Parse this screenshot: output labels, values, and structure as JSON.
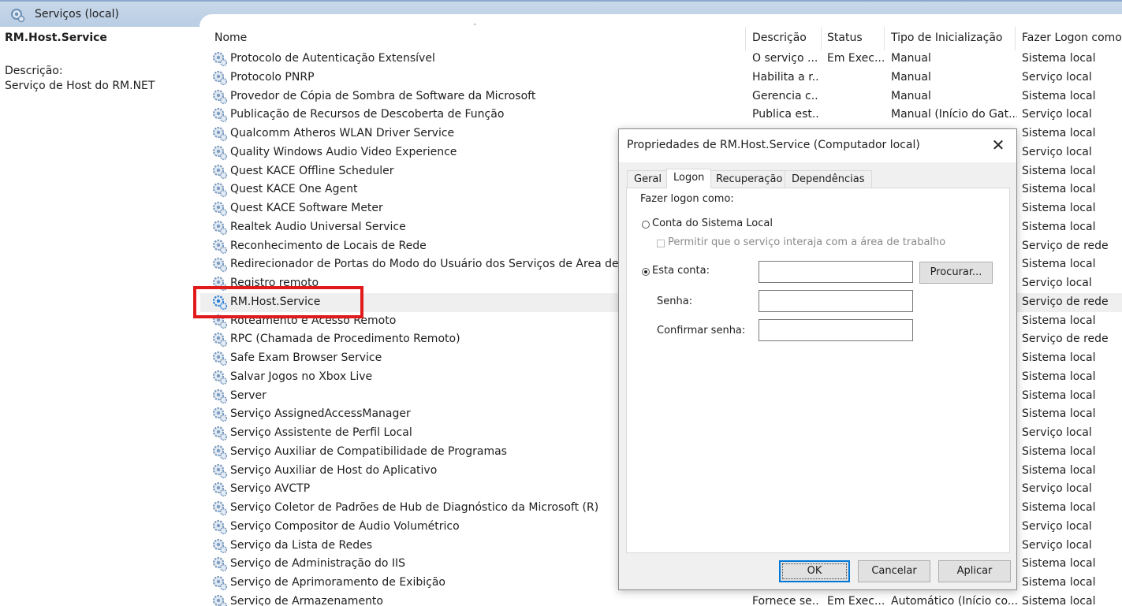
{
  "window": {
    "title": "Serviços (local)"
  },
  "left_pane": {
    "title": "RM.Host.Service",
    "description_label": "Descrição:",
    "description": "Serviço de Host do RM.NET"
  },
  "columns": {
    "name": "Nome",
    "description": "Descrição",
    "status": "Status",
    "startup": "Tipo de Inicialização",
    "logon": "Fazer Logon como"
  },
  "services": [
    {
      "name": "Protocolo de Autenticação Extensível",
      "desc": "O serviço ...",
      "status": "Em Exec...",
      "startup": "Manual",
      "logon": "Sistema local"
    },
    {
      "name": "Protocolo PNRP",
      "desc": "Habilita a r...",
      "status": "",
      "startup": "Manual",
      "logon": "Serviço local"
    },
    {
      "name": "Provedor de Cópia de Sombra de Software da Microsoft",
      "desc": "Gerencia c...",
      "status": "",
      "startup": "Manual",
      "logon": "Sistema local"
    },
    {
      "name": "Publicação de Recursos de Descoberta de Função",
      "desc": "Publica est...",
      "status": "",
      "startup": "Manual (Início do Gat...",
      "logon": "Serviço local"
    },
    {
      "name": "Qualcomm Atheros WLAN Driver Service",
      "desc": "",
      "status": "",
      "startup": "",
      "logon": "Sistema local"
    },
    {
      "name": "Quality Windows Audio Video Experience",
      "desc": "",
      "status": "",
      "startup": "",
      "logon": "Serviço local"
    },
    {
      "name": "Quest KACE Offline Scheduler",
      "desc": "",
      "status": "",
      "startup": "",
      "logon": "Sistema local"
    },
    {
      "name": "Quest KACE One Agent",
      "desc": "",
      "status": "",
      "startup": "",
      "logon": "Sistema local"
    },
    {
      "name": "Quest KACE Software Meter",
      "desc": "",
      "status": "",
      "startup": "",
      "logon": "Sistema local"
    },
    {
      "name": "Realtek Audio Universal Service",
      "desc": "",
      "status": "",
      "startup": "",
      "logon": "Sistema local"
    },
    {
      "name": "Reconhecimento de Locais de Rede",
      "desc": "",
      "status": "",
      "startup": "",
      "logon": "Serviço de rede"
    },
    {
      "name": "Redirecionador de Portas do Modo do Usuário dos Serviços de Área de Trabalho Remota",
      "desc": "",
      "status": "",
      "startup": "",
      "logon": "Sistema local"
    },
    {
      "name": "Registro remoto",
      "desc": "",
      "status": "",
      "startup": "",
      "logon": "Serviço local"
    },
    {
      "name": "RM.Host.Service",
      "desc": "",
      "status": "",
      "startup": "",
      "logon": "Serviço de rede",
      "selected": true
    },
    {
      "name": "Roteamento e Acesso Remoto",
      "desc": "",
      "status": "",
      "startup": "",
      "logon": "Sistema local"
    },
    {
      "name": "RPC (Chamada de Procedimento Remoto)",
      "desc": "",
      "status": "",
      "startup": "",
      "logon": "Serviço de rede"
    },
    {
      "name": "Safe Exam Browser Service",
      "desc": "",
      "status": "",
      "startup": "",
      "logon": "Sistema local"
    },
    {
      "name": "Salvar Jogos no Xbox Live",
      "desc": "",
      "status": "",
      "startup": "",
      "logon": "Sistema local"
    },
    {
      "name": "Server",
      "desc": "",
      "status": "",
      "startup": "",
      "logon": "Sistema local"
    },
    {
      "name": "Serviço AssignedAccessManager",
      "desc": "",
      "status": "",
      "startup": "",
      "logon": "Sistema local"
    },
    {
      "name": "Serviço Assistente de Perfil Local",
      "desc": "",
      "status": "",
      "startup": "",
      "logon": "Serviço local"
    },
    {
      "name": "Serviço Auxiliar de Compatibilidade de Programas",
      "desc": "",
      "status": "",
      "startup": "",
      "logon": "Sistema local"
    },
    {
      "name": "Serviço Auxiliar de Host do Aplicativo",
      "desc": "",
      "status": "",
      "startup": "",
      "logon": "Sistema local"
    },
    {
      "name": "Serviço AVCTP",
      "desc": "",
      "status": "",
      "startup": "",
      "logon": "Serviço local"
    },
    {
      "name": "Serviço Coletor de Padrões de Hub de Diagnóstico da Microsoft (R)",
      "desc": "",
      "status": "",
      "startup": "",
      "logon": "Sistema local"
    },
    {
      "name": "Serviço Compositor de Áudio Volumétrico",
      "desc": "",
      "status": "",
      "startup": "",
      "logon": "Serviço local"
    },
    {
      "name": "Serviço da Lista de Redes",
      "desc": "",
      "status": "",
      "startup": "",
      "logon": "Serviço local"
    },
    {
      "name": "Serviço de Administração do IIS",
      "desc": "",
      "status": "",
      "startup": "",
      "logon": "Sistema local"
    },
    {
      "name": "Serviço de Aprimoramento de Exibição",
      "desc": "",
      "status": "",
      "startup": "",
      "logon": "Sistema local"
    },
    {
      "name": "Serviço de Armazenamento",
      "desc": "Fornece se...",
      "status": "Em Exec...",
      "startup": "Automático (Início co...",
      "logon": "Sistema local"
    }
  ],
  "dialog": {
    "title": "Propriedades de RM.Host.Service (Computador local)",
    "close_glyph": "✕",
    "tabs": [
      "Geral",
      "Logon",
      "Recuperação",
      "Dependências"
    ],
    "active_tab": "Logon",
    "logon_as_label": "Fazer logon como:",
    "local_system_label": "Conta do Sistema Local",
    "interact_label": "Permitir que o serviço interaja com a área de trabalho",
    "this_account_label": "Esta conta:",
    "password_label": "Senha:",
    "confirm_password_label": "Confirmar senha:",
    "account_value": "",
    "password_value": "",
    "confirm_value": "",
    "browse_button": "Procurar...",
    "ok_button": "OK",
    "cancel_button": "Cancelar",
    "apply_button": "Aplicar",
    "selected_option": "this_account"
  },
  "colors": {
    "highlight_box": "#e11b1b",
    "header_band": "#c9d8ea",
    "selected_row": "#efefef"
  }
}
